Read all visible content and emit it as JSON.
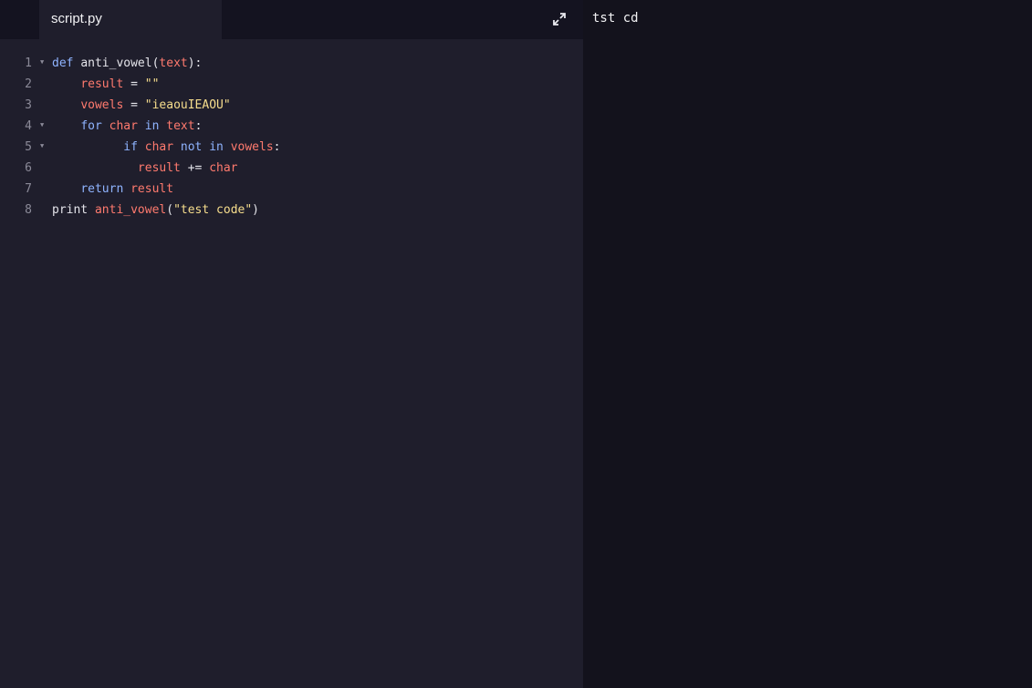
{
  "tab": {
    "filename": "script.py"
  },
  "toolbar": {
    "expand_icon": "expand-icon"
  },
  "code": {
    "line_numbers": [
      "1",
      "2",
      "3",
      "4",
      "5",
      "6",
      "7",
      "8"
    ],
    "lines": [
      [
        {
          "t": "def ",
          "c": "kw"
        },
        {
          "t": "anti_vowel",
          "c": "pl"
        },
        {
          "t": "(",
          "c": "pl"
        },
        {
          "t": "text",
          "c": "var"
        },
        {
          "t": "):",
          "c": "pl"
        }
      ],
      [
        {
          "t": "    ",
          "c": "pl"
        },
        {
          "t": "result",
          "c": "var"
        },
        {
          "t": " = ",
          "c": "pl"
        },
        {
          "t": "\"\"",
          "c": "str"
        }
      ],
      [
        {
          "t": "    ",
          "c": "pl"
        },
        {
          "t": "vowels",
          "c": "var"
        },
        {
          "t": " = ",
          "c": "pl"
        },
        {
          "t": "\"ieaouIEAOU\"",
          "c": "str"
        }
      ],
      [
        {
          "t": "    ",
          "c": "pl"
        },
        {
          "t": "for",
          "c": "kw"
        },
        {
          "t": " ",
          "c": "pl"
        },
        {
          "t": "char",
          "c": "var"
        },
        {
          "t": " ",
          "c": "pl"
        },
        {
          "t": "in",
          "c": "kw"
        },
        {
          "t": " ",
          "c": "pl"
        },
        {
          "t": "text",
          "c": "var"
        },
        {
          "t": ":",
          "c": "pl"
        }
      ],
      [
        {
          "t": "          ",
          "c": "pl"
        },
        {
          "t": "if",
          "c": "kw"
        },
        {
          "t": " ",
          "c": "pl"
        },
        {
          "t": "char",
          "c": "var"
        },
        {
          "t": " ",
          "c": "pl"
        },
        {
          "t": "not",
          "c": "kw"
        },
        {
          "t": " ",
          "c": "pl"
        },
        {
          "t": "in",
          "c": "kw"
        },
        {
          "t": " ",
          "c": "pl"
        },
        {
          "t": "vowels",
          "c": "var"
        },
        {
          "t": ":",
          "c": "pl"
        }
      ],
      [
        {
          "t": "            ",
          "c": "pl"
        },
        {
          "t": "result",
          "c": "var"
        },
        {
          "t": " += ",
          "c": "pl"
        },
        {
          "t": "char",
          "c": "var"
        }
      ],
      [
        {
          "t": "    ",
          "c": "pl"
        },
        {
          "t": "return",
          "c": "kw"
        },
        {
          "t": " ",
          "c": "pl"
        },
        {
          "t": "result",
          "c": "var"
        }
      ],
      [
        {
          "t": "print ",
          "c": "pl"
        },
        {
          "t": "anti_vowel",
          "c": "var"
        },
        {
          "t": "(",
          "c": "pl"
        },
        {
          "t": "\"test code\"",
          "c": "str"
        },
        {
          "t": ")",
          "c": "pl"
        }
      ]
    ],
    "foldable_lines": [
      0,
      3,
      4
    ]
  },
  "output": {
    "text": "tst cd"
  },
  "colors": {
    "keyword": "#8fb4ff",
    "variable": "#ff7a6e",
    "string": "#f7de8d",
    "plain": "#e4e4ea"
  }
}
